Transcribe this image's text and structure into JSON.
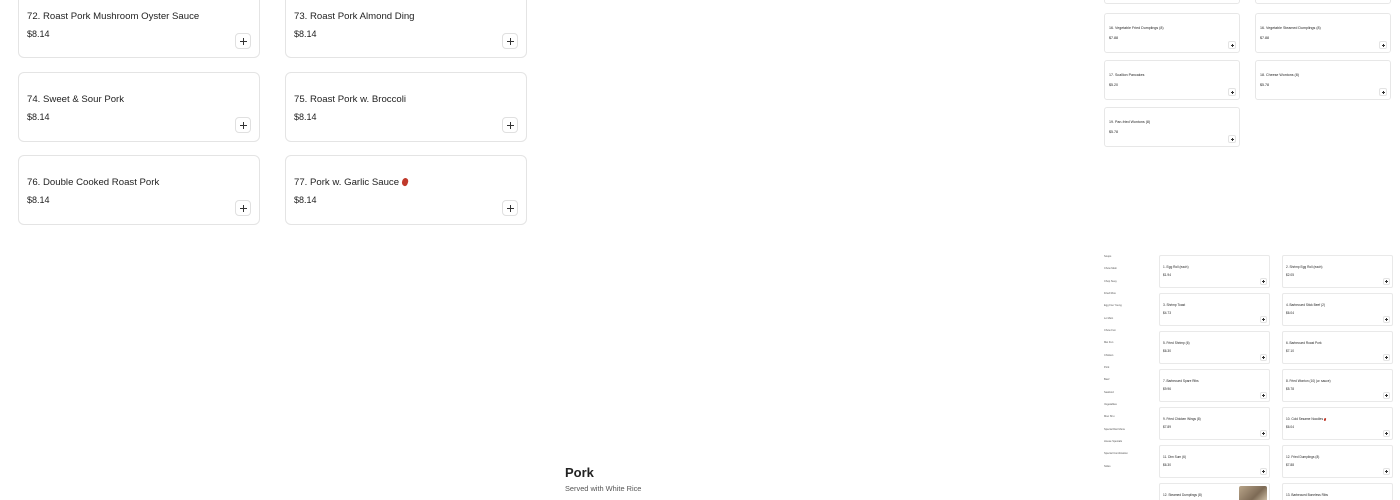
{
  "main_items": [
    {
      "name": "72. Roast Pork Mushroom Oyster Sauce",
      "price": "$8.14",
      "spicy": false
    },
    {
      "name": "73. Roast Pork Almond Ding",
      "price": "$8.14",
      "spicy": false
    },
    {
      "name": "74. Sweet & Sour Pork",
      "price": "$8.14",
      "spicy": false
    },
    {
      "name": "75. Roast Pork w. Broccoli",
      "price": "$8.14",
      "spicy": false
    },
    {
      "name": "76. Double Cooked Roast Pork",
      "price": "$8.14",
      "spicy": false
    },
    {
      "name": "77. Pork w. Garlic Sauce",
      "price": "$8.14",
      "spicy": true
    }
  ],
  "side_items": [
    {
      "name": "16. Vegetable Fried Dumplings (8)",
      "price": "$7.88"
    },
    {
      "name": "16. Vegetable Steamed Dumplings (8)",
      "price": "$7.88"
    },
    {
      "name": "17. Scallion Pancakes",
      "price": "$5.20"
    },
    {
      "name": "18. Cheese Wontons (8)",
      "price": "$5.78"
    },
    {
      "name": "19. Pan-fried Wontons (8)",
      "price": "$5.78"
    }
  ],
  "categories": [
    "Soups",
    "Chow Mein",
    "Chop Suey",
    "Fried Rice",
    "Egg Foo Young",
    "Lo Mein",
    "Chow Fun",
    "Mei Fun",
    "Chicken",
    "Pork",
    "Beef",
    "Seafood",
    "Vegetables",
    "Moo Shu",
    "Special Diet Menu",
    "House Specials",
    "Special Combination",
    "Sides"
  ],
  "appetizers": [
    {
      "name": "1. Egg Roll (each)",
      "price": "$1.94"
    },
    {
      "name": "2. Shrimp Egg Roll (each)",
      "price": "$2.05"
    },
    {
      "name": "3. Shrimp Toast",
      "price": "$4.73"
    },
    {
      "name": "4. Barbecued Stick Beef (2)",
      "price": "$6.04"
    },
    {
      "name": "5. Fried Shrimp (6)",
      "price": "$6.30"
    },
    {
      "name": "6. Barbecued Roast Pork",
      "price": "$7.10"
    },
    {
      "name": "7. Barbecued Spare Ribs",
      "price": "$9.96"
    },
    {
      "name": "8. Fried Wonton (10) (w. sauce)",
      "price": "$5.78"
    },
    {
      "name": "9. Fried Chicken Wings (8)",
      "price": "$7.89"
    },
    {
      "name": "10. Cold Sesame Noodles",
      "price": "$6.04",
      "spicy": true
    },
    {
      "name": "11. Dim Sum (6)",
      "price": "$6.30"
    },
    {
      "name": "12. Fried Dumplings (8)",
      "price": "$7.88"
    },
    {
      "name": "12. Steamed Dumplings (8)",
      "price": "",
      "image": true
    },
    {
      "name": "13. Barbecued Boneless Ribs",
      "price": ""
    }
  ],
  "section": {
    "title": "Pork",
    "subtitle": "Served with White Rice"
  },
  "icons": {
    "add": "plus-icon",
    "spicy": "chili-pepper-icon"
  },
  "colors": {
    "card_border": "#e4e4e4",
    "spicy": "#c0392b",
    "text": "#222222"
  }
}
